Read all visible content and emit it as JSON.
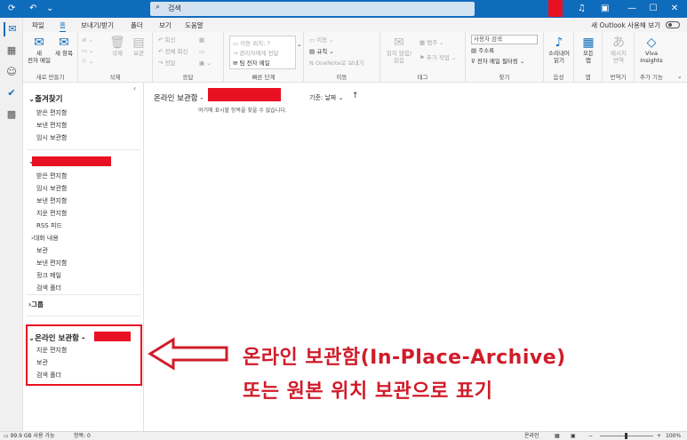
{
  "window": {
    "search_placeholder": "검색",
    "minimize": "—",
    "maximize": "☐",
    "close": "✕"
  },
  "tabs": {
    "items": [
      "파일",
      "홈",
      "보내기/받기",
      "폴더",
      "보기",
      "도움말"
    ],
    "active": "홈",
    "new_outlook_label": "새 Outlook 사용해 보기"
  },
  "ribbon": {
    "groups": {
      "new": "새로 만들기",
      "delete": "삭제",
      "respond": "응답",
      "quick_steps": "빠른 단계",
      "move": "이동",
      "tags": "태그",
      "find": "찾기",
      "voice": "음성",
      "apps": "앱",
      "translate": "번역기",
      "addins": "추가 기능"
    },
    "new_email": "새\n전자 메일",
    "new_items": "새 항목",
    "delete_btn": "삭제",
    "archive_btn": "보관",
    "reply": "회신",
    "reply_all": "전체 회신",
    "forward": "전달",
    "qs_move": "이동 위치: ?",
    "qs_to_manager": "관리자에게 전달",
    "qs_team_email": "팀 전자 메일",
    "move_btn": "이동",
    "rules": "규칙",
    "onenote": "OneNote로 보내기",
    "unread": "읽지 않음/\n읽음",
    "categorize": "범주",
    "followup": "추가 작업",
    "search_people": "사용자 검색",
    "address_book": "주소록",
    "filter_email": "전자 메일 필터링",
    "dictate": "소리내어\n읽기",
    "all_apps": "모든\n앱",
    "translate_btn": "메시지\n번역",
    "viva": "Viva\nInsights"
  },
  "folders": {
    "favorites_header": "즐겨찾기",
    "favorites": [
      "받은 편지함",
      "보낸 편지함",
      "임시 보관함"
    ],
    "account_items": [
      "받은 편지함",
      "임시 보관함",
      "보낸 편지함",
      "지운 편지함",
      "RSS 피드",
      "대화 내용",
      "보관",
      "보낸 편지함",
      "정크 메일",
      "검색 폴더"
    ],
    "groups_header": "그룹",
    "archive_header": "온라인 보관함 -",
    "archive_items": [
      "지운 편지함",
      "보관",
      "검색 폴더"
    ]
  },
  "message_list": {
    "title": "온라인 보관함 -",
    "sort_label": "기준: 날짜",
    "empty_text": "여기에 표시할 항목을 찾을 수 없습니다."
  },
  "annotation": {
    "line1": "온라인 보관함(In-Place-Archive)",
    "line2": "또는 원본 위치 보관으로 표기"
  },
  "status": {
    "storage": "99.9 GB 사용 가능",
    "items": "항목: 0",
    "online": "온라인",
    "zoom": "100%"
  },
  "colors": {
    "accent": "#0f6cbd",
    "redaction": "#e81123",
    "annotation": "#d01c2a"
  }
}
